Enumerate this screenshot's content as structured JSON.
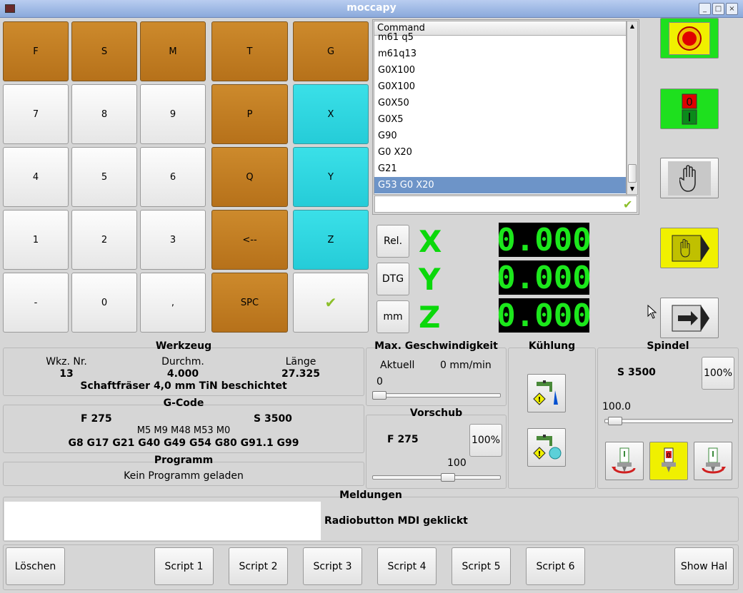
{
  "window": {
    "title": "moccapy"
  },
  "keypad": {
    "rows": [
      [
        {
          "label": "F",
          "color": "orange"
        },
        {
          "label": "S",
          "color": "orange"
        },
        {
          "label": "M",
          "color": "orange"
        },
        {
          "label": "T",
          "color": "orange"
        },
        {
          "label": "G",
          "color": "orange"
        }
      ],
      [
        {
          "label": "7",
          "color": "white"
        },
        {
          "label": "8",
          "color": "white"
        },
        {
          "label": "9",
          "color": "white"
        },
        {
          "label": "P",
          "color": "orange"
        },
        {
          "label": "X",
          "color": "cyan"
        }
      ],
      [
        {
          "label": "4",
          "color": "white"
        },
        {
          "label": "5",
          "color": "white"
        },
        {
          "label": "6",
          "color": "white"
        },
        {
          "label": "Q",
          "color": "orange"
        },
        {
          "label": "Y",
          "color": "cyan"
        }
      ],
      [
        {
          "label": "1",
          "color": "white"
        },
        {
          "label": "2",
          "color": "white"
        },
        {
          "label": "3",
          "color": "white"
        },
        {
          "label": "<--",
          "color": "orange"
        },
        {
          "label": "Z",
          "color": "cyan"
        }
      ],
      [
        {
          "label": "-",
          "color": "white"
        },
        {
          "label": "0",
          "color": "white"
        },
        {
          "label": ",",
          "color": "white"
        },
        {
          "label": "SPC",
          "color": "orange"
        },
        {
          "label": "",
          "color": "white",
          "icon": "checkmark-icon"
        }
      ]
    ]
  },
  "command": {
    "header": "Command",
    "items": [
      "m61 q5",
      "m61q13",
      "G0X100",
      "G0X100",
      "G0X50",
      "G0X5",
      "G90",
      "G0 X20",
      "G21",
      "G53 G0 X20"
    ],
    "selected_index": 9,
    "input_value": ""
  },
  "dro": {
    "buttons": [
      "Rel.",
      "DTG",
      "mm"
    ],
    "axes": [
      {
        "name": "X",
        "value": "0.000"
      },
      {
        "name": "Y",
        "value": "0.000"
      },
      {
        "name": "Z",
        "value": "0.000"
      }
    ]
  },
  "werkzeug": {
    "title": "Werkzeug",
    "nr_label": "Wkz. Nr.",
    "nr": "13",
    "durchm_label": "Durchm.",
    "durchm": "4.000",
    "laenge_label": "Länge",
    "laenge": "27.325",
    "desc": "Schaftfräser 4,0 mm TiN beschichtet"
  },
  "gcode": {
    "title": "G-Code",
    "f": "F 275",
    "s": "S 3500",
    "mcodes": "M5 M9 M48 M53 M0",
    "gcodes": "G8 G17 G21 G40 G49 G54 G80 G91.1 G99"
  },
  "programm": {
    "title": "Programm",
    "text": "Kein Programm geladen"
  },
  "maxspeed": {
    "title": "Max. Geschwindigkeit",
    "label": "Aktuell",
    "value": "0 mm/min",
    "slider_value": "0",
    "slider_fraction": 0.0
  },
  "vorschub": {
    "title": "Vorschub",
    "f": "F 275",
    "pct": "100%",
    "slider_value": "100",
    "slider_fraction": 0.6
  },
  "kuehlung": {
    "title": "Kühlung"
  },
  "spindel": {
    "title": "Spindel",
    "s": "S 3500",
    "pct": "100%",
    "slider_value": "100.0",
    "slider_fraction": 0.03
  },
  "meldungen": {
    "title": "Meldungen",
    "text": "Radiobutton MDI geklickt"
  },
  "bottom": {
    "loeschen": "Löschen",
    "scripts": [
      "Script 1",
      "Script 2",
      "Script 3",
      "Script 4",
      "Script 5",
      "Script 6"
    ],
    "hal": "Show Hal"
  },
  "colors": {
    "orange": "#c27e25",
    "cyan": "#2ad6e0",
    "dro_green": "#1ce81c",
    "estop_green": "#1ee01e",
    "estop_yellow": "#f0f000",
    "selection": "#6d94c8"
  }
}
